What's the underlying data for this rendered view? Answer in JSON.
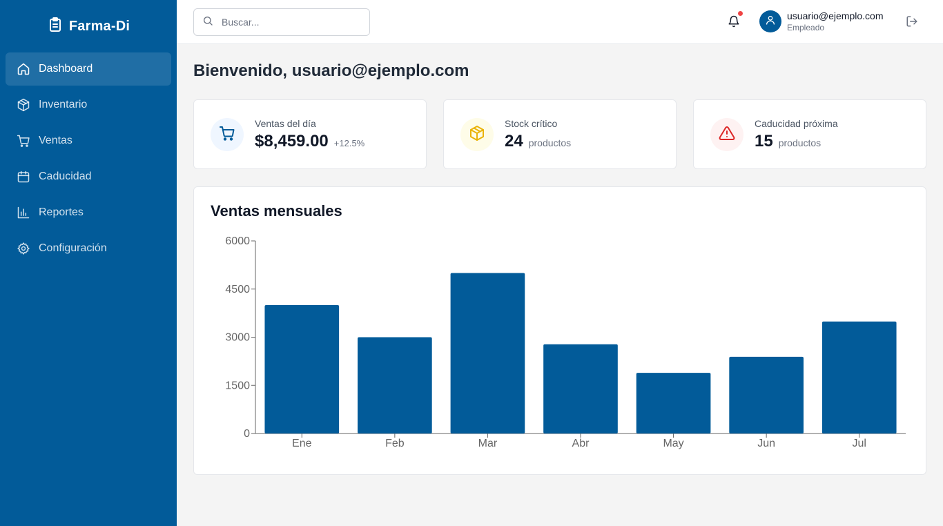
{
  "brand": {
    "name": "Farma-Di"
  },
  "sidebar": {
    "items": [
      {
        "label": "Dashboard",
        "icon": "home-icon",
        "active": true
      },
      {
        "label": "Inventario",
        "icon": "box-icon",
        "active": false
      },
      {
        "label": "Ventas",
        "icon": "cart-icon",
        "active": false
      },
      {
        "label": "Caducidad",
        "icon": "calendar-icon",
        "active": false
      },
      {
        "label": "Reportes",
        "icon": "bar-chart-icon",
        "active": false
      },
      {
        "label": "Configuración",
        "icon": "gear-icon",
        "active": false
      }
    ]
  },
  "header": {
    "search_placeholder": "Buscar...",
    "user_email": "usuario@ejemplo.com",
    "user_role": "Empleado",
    "notification_dot": true
  },
  "main": {
    "welcome": "Bienvenido, usuario@ejemplo.com",
    "cards": [
      {
        "title": "Ventas del día",
        "value": "$8,459.00",
        "sub": "+12.5%",
        "icon": "cart-icon",
        "color": "#025b99",
        "bg": "#eff6ff"
      },
      {
        "title": "Stock crítico",
        "value": "24",
        "sub": "productos",
        "icon": "box-icon",
        "color": "#eab308",
        "bg": "#fefce8"
      },
      {
        "title": "Caducidad próxima",
        "value": "15",
        "sub": "productos",
        "icon": "alert-triangle-icon",
        "color": "#dc2626",
        "bg": "#fef2f2"
      }
    ]
  },
  "chart_data": {
    "type": "bar",
    "title": "Ventas mensuales",
    "categories": [
      "Ene",
      "Feb",
      "Mar",
      "Abr",
      "May",
      "Jun",
      "Jul"
    ],
    "values": [
      4000,
      3000,
      5000,
      2780,
      1890,
      2390,
      3490
    ],
    "yticks": [
      0,
      1500,
      3000,
      4500,
      6000
    ],
    "ylim": [
      0,
      6000
    ],
    "bar_color": "#025b99",
    "xlabel": "",
    "ylabel": "",
    "grid": false
  },
  "colors": {
    "primary": "#025b99",
    "background": "#f4f4f4"
  }
}
